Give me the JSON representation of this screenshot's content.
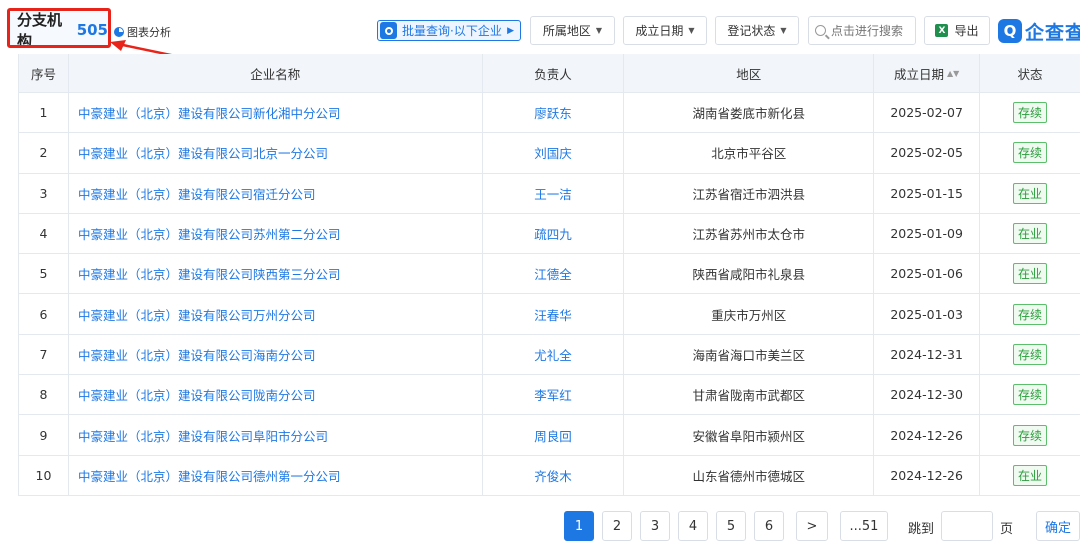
{
  "header": {
    "title": "分支机构",
    "count": "505",
    "chart_link": "图表分析",
    "batch_query": "批量查询·以下企业",
    "filters": [
      {
        "label": "所属地区"
      },
      {
        "label": "成立日期"
      },
      {
        "label": "登记状态"
      }
    ],
    "search_placeholder": "点击进行搜索",
    "export_label": "导出",
    "logo_text": "企查查",
    "logo_mark": "Q"
  },
  "table": {
    "columns": [
      "序号",
      "企业名称",
      "负责人",
      "地区",
      "成立日期",
      "状态"
    ],
    "rows": [
      {
        "no": "1",
        "name": "中豪建业（北京）建设有限公司新化湘中分公司",
        "person": "廖跃东",
        "region": "湖南省娄底市新化县",
        "date": "2025-02-07",
        "status": "存续"
      },
      {
        "no": "2",
        "name": "中豪建业（北京）建设有限公司北京一分公司",
        "person": "刘国庆",
        "region": "北京市平谷区",
        "date": "2025-02-05",
        "status": "存续"
      },
      {
        "no": "3",
        "name": "中豪建业（北京）建设有限公司宿迁分公司",
        "person": "王一洁",
        "region": "江苏省宿迁市泗洪县",
        "date": "2025-01-15",
        "status": "在业"
      },
      {
        "no": "4",
        "name": "中豪建业（北京）建设有限公司苏州第二分公司",
        "person": "疏四九",
        "region": "江苏省苏州市太仓市",
        "date": "2025-01-09",
        "status": "在业"
      },
      {
        "no": "5",
        "name": "中豪建业（北京）建设有限公司陕西第三分公司",
        "person": "江德全",
        "region": "陕西省咸阳市礼泉县",
        "date": "2025-01-06",
        "status": "在业"
      },
      {
        "no": "6",
        "name": "中豪建业（北京）建设有限公司万州分公司",
        "person": "汪春华",
        "region": "重庆市万州区",
        "date": "2025-01-03",
        "status": "存续"
      },
      {
        "no": "7",
        "name": "中豪建业（北京）建设有限公司海南分公司",
        "person": "尤礼全",
        "region": "海南省海口市美兰区",
        "date": "2024-12-31",
        "status": "存续"
      },
      {
        "no": "8",
        "name": "中豪建业（北京）建设有限公司陇南分公司",
        "person": "李军红",
        "region": "甘肃省陇南市武都区",
        "date": "2024-12-30",
        "status": "存续"
      },
      {
        "no": "9",
        "name": "中豪建业（北京）建设有限公司阜阳市分公司",
        "person": "周良回",
        "region": "安徽省阜阳市颍州区",
        "date": "2024-12-26",
        "status": "存续"
      },
      {
        "no": "10",
        "name": "中豪建业（北京）建设有限公司德州第一分公司",
        "person": "齐俊木",
        "region": "山东省德州市德城区",
        "date": "2024-12-26",
        "status": "在业"
      }
    ]
  },
  "pagination": {
    "pages": [
      "1",
      "2",
      "3",
      "4",
      "5",
      "6"
    ],
    "current": "1",
    "next": ">",
    "last": "...51",
    "goto_label": "跳到",
    "page_unit": "页",
    "confirm": "确定"
  },
  "colors": {
    "accent": "#1e78e4",
    "annotation": "#e8231a",
    "status_green": "#2a9d3c"
  }
}
